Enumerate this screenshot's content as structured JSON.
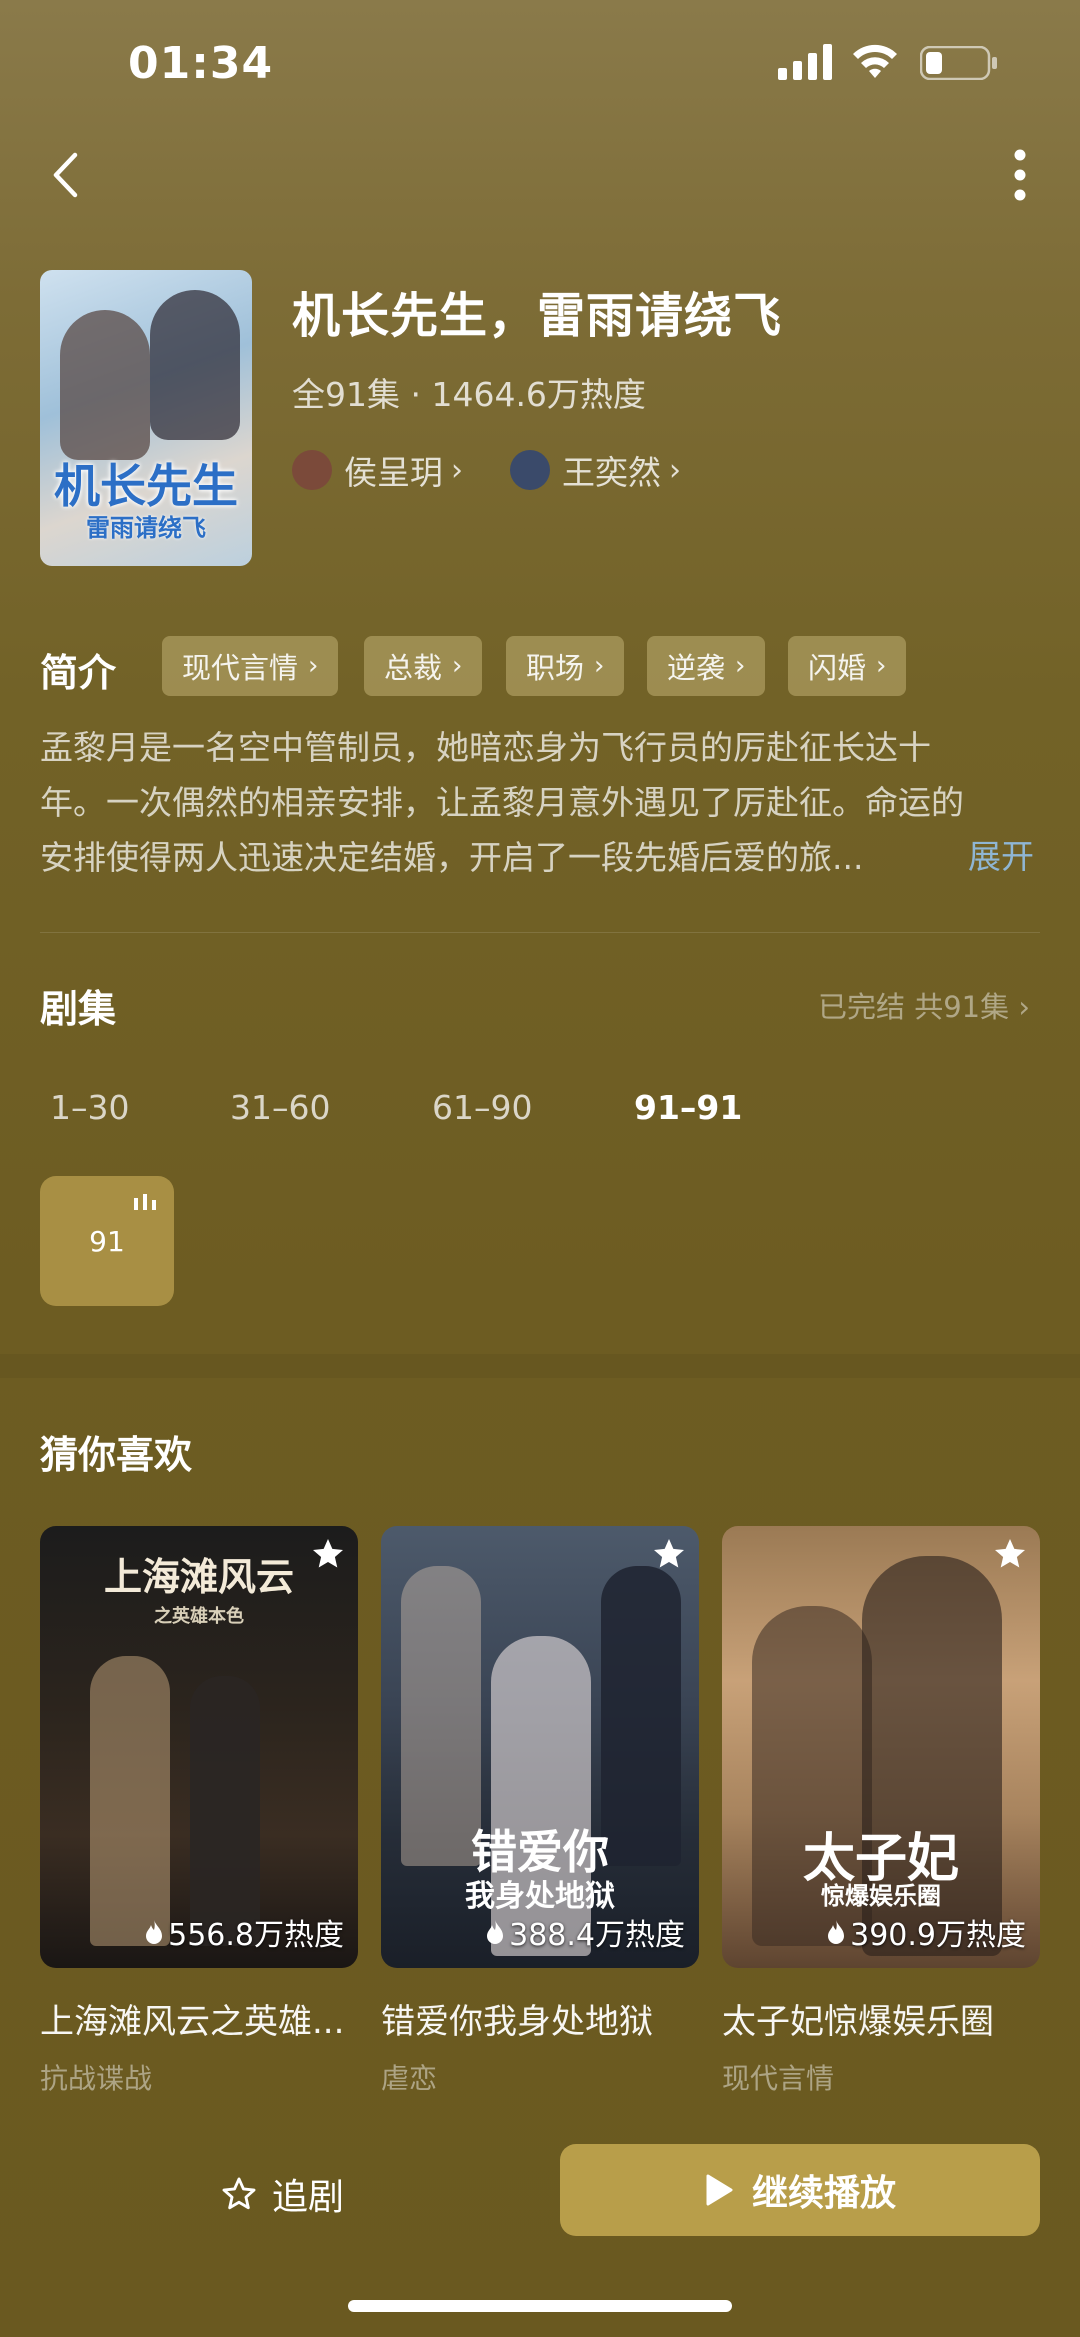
{
  "status": {
    "time": "01:34"
  },
  "show": {
    "title": "机长先生，雷雨请绕飞",
    "meta": "全91集 · 1464.6万热度",
    "poster_title": "机长先生",
    "poster_subtitle": "雷雨请绕飞",
    "actors": [
      {
        "name": "侯呈玥",
        "avatar_color": "#7b4a3a"
      },
      {
        "name": "王奕然",
        "avatar_color": "#3a4a6a"
      }
    ]
  },
  "intro": {
    "label": "简介",
    "tags": [
      "现代言情",
      "总裁",
      "职场",
      "逆袭",
      "闪婚"
    ],
    "synopsis_lines": [
      "孟黎月是一名空中管制员，她暗恋身为飞行员的厉赴征长达十",
      "年。一次偶然的相亲安排，让孟黎月意外遇见了厉赴征。命运的",
      "安排使得两人迅速决定结婚，开启了一段先婚后爱的旅..."
    ],
    "expand_label": "展开"
  },
  "episodes": {
    "label": "剧集",
    "status": "已完结 共91集",
    "ranges": [
      "1–30",
      "31–60",
      "61–90",
      "91–91"
    ],
    "active_range": "91–91",
    "items": [
      "91"
    ]
  },
  "recommend": {
    "label": "猜你喜欢",
    "items": [
      {
        "title": "上海滩风云之英雄...",
        "genre": "抗战谍战",
        "heat": "556.8万热度",
        "cover_text": "上海滩风云",
        "cover_sub": "之英雄本色"
      },
      {
        "title": "错爱你我身处地狱",
        "genre": "虐恋",
        "heat": "388.4万热度",
        "cover_text": "错爱你",
        "cover_sub": "我身处地狱"
      },
      {
        "title": "太子妃惊爆娱乐圈",
        "genre": "现代言情",
        "heat": "390.9万热度",
        "cover_text": "太子妃",
        "cover_sub": "惊爆娱乐圈"
      }
    ]
  },
  "bottom": {
    "follow_label": "追剧",
    "play_label": "继续播放"
  },
  "colors": {
    "accent": "#b89e4a",
    "tag_bg": "#a59458",
    "link": "#8fb6d4"
  }
}
